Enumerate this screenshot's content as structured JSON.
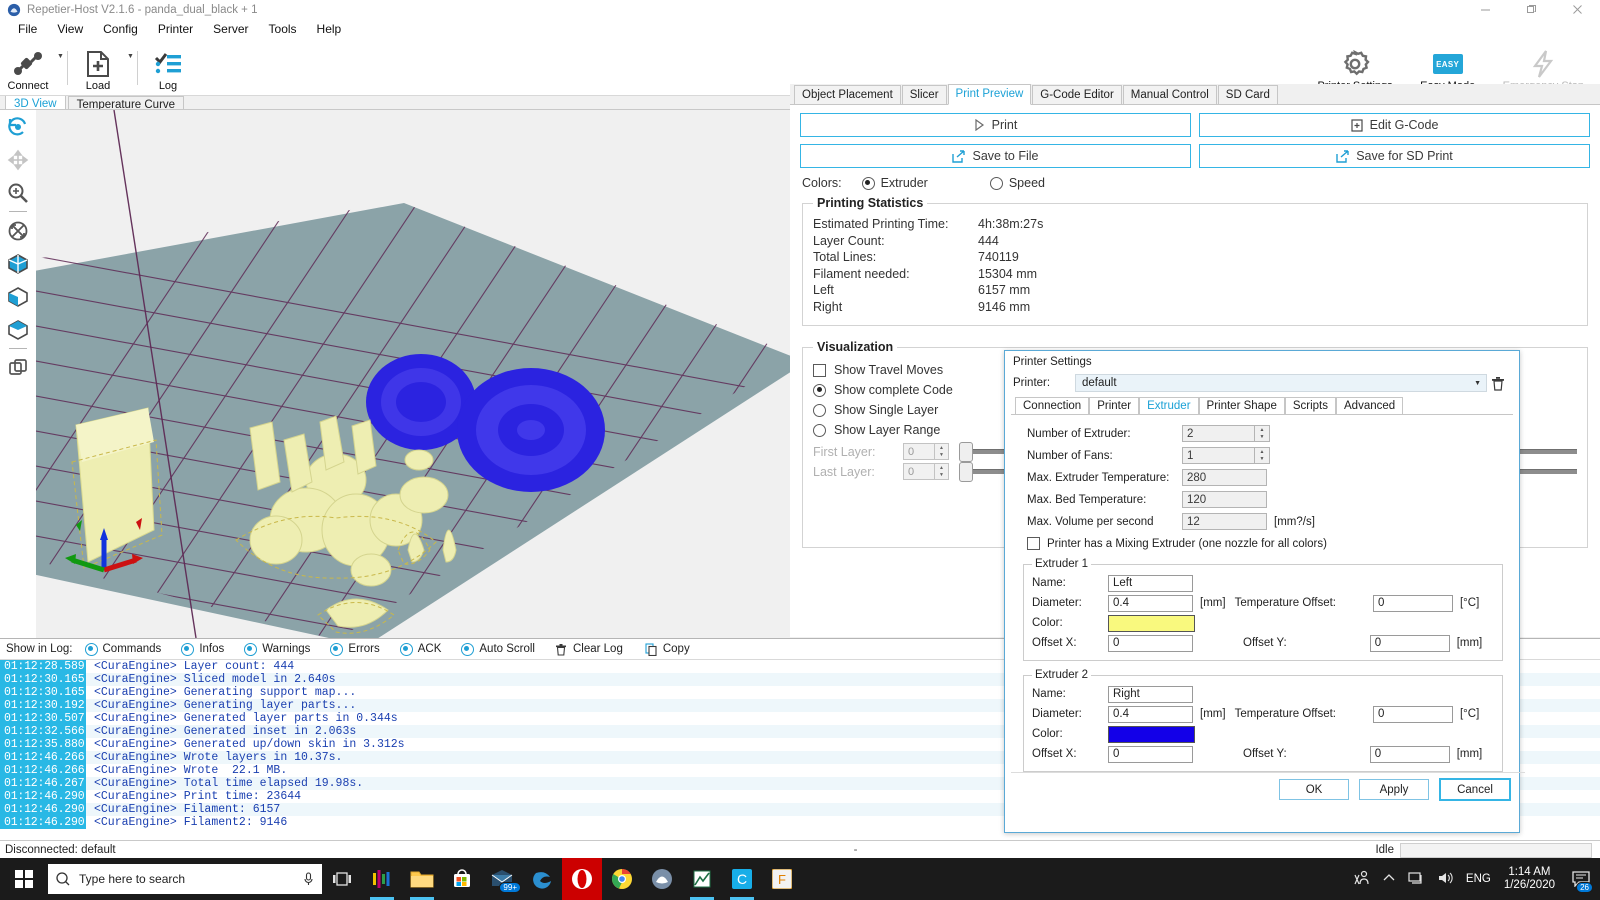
{
  "window": {
    "title": "Repetier-Host V2.1.6 - panda_dual_black + 1",
    "minimize": "—",
    "maximize": "❐",
    "close": "✕"
  },
  "menubar": {
    "items": [
      "File",
      "View",
      "Config",
      "Printer",
      "Server",
      "Tools",
      "Help"
    ]
  },
  "toolbar": {
    "connect": "Connect",
    "load": "Load",
    "log": "Log",
    "printer_settings": "Printer Settings",
    "easy_mode": "Easy Mode",
    "easy_badge": "EASY",
    "emergency_stop": "Emergency Stop"
  },
  "left_tabs": {
    "items": [
      "3D View",
      "Temperature Curve"
    ],
    "selected": "3D View"
  },
  "view_tools": [
    "rotate-view-icon",
    "move-view-icon",
    "zoom-view-icon",
    "center-view-icon",
    "view-solid-icon",
    "view-perspective-icon",
    "view-top-icon",
    "view-wire-icon"
  ],
  "right_tabs": {
    "items": [
      "Object Placement",
      "Slicer",
      "Print Preview",
      "G-Code Editor",
      "Manual Control",
      "SD Card"
    ],
    "selected": "Print Preview"
  },
  "actions": {
    "print": "Print",
    "edit_gcode": "Edit G-Code",
    "save_to_file": "Save to File",
    "save_for_sd": "Save for SD Print"
  },
  "colors_row": {
    "label": "Colors:",
    "extruder": "Extruder",
    "speed": "Speed",
    "selected": "Extruder"
  },
  "printing_statistics": {
    "legend": "Printing Statistics",
    "rows": [
      {
        "key": "Estimated Printing Time:",
        "value": "4h:38m:27s"
      },
      {
        "key": "Layer Count:",
        "value": "444"
      },
      {
        "key": "Total Lines:",
        "value": "740119"
      },
      {
        "key": "Filament needed:",
        "value": "15304 mm"
      },
      {
        "key": "Left",
        "value": "6157 mm"
      },
      {
        "key": "Right",
        "value": "9146 mm"
      }
    ]
  },
  "visualization": {
    "legend": "Visualization",
    "show_travel_moves": "Show Travel Moves",
    "show_complete_code": "Show complete Code",
    "show_single_layer": "Show Single Layer",
    "show_layer_range": "Show Layer Range",
    "selected": "Show complete Code",
    "first_layer_label": "First Layer:",
    "first_layer_value": "0",
    "last_layer_label": "Last Layer:",
    "last_layer_value": "0"
  },
  "log": {
    "show_in_log": "Show in Log:",
    "filters": [
      "Commands",
      "Infos",
      "Warnings",
      "Errors",
      "ACK",
      "Auto Scroll"
    ],
    "clear_log": "Clear Log",
    "copy": "Copy",
    "lines": [
      {
        "ts": "01:12:28.589",
        "msg": "<CuraEngine> Layer count: 444"
      },
      {
        "ts": "01:12:30.165",
        "msg": "<CuraEngine> Sliced model in 2.640s"
      },
      {
        "ts": "01:12:30.165",
        "msg": "<CuraEngine> Generating support map..."
      },
      {
        "ts": "01:12:30.192",
        "msg": "<CuraEngine> Generating layer parts..."
      },
      {
        "ts": "01:12:30.507",
        "msg": "<CuraEngine> Generated layer parts in 0.344s"
      },
      {
        "ts": "01:12:32.566",
        "msg": "<CuraEngine> Generated inset in 2.063s"
      },
      {
        "ts": "01:12:35.880",
        "msg": "<CuraEngine> Generated up/down skin in 3.312s"
      },
      {
        "ts": "01:12:46.266",
        "msg": "<CuraEngine> Wrote layers in 10.37s."
      },
      {
        "ts": "01:12:46.266",
        "msg": "<CuraEngine> Wrote  22.1 MB."
      },
      {
        "ts": "01:12:46.267",
        "msg": "<CuraEngine> Total time elapsed 19.98s."
      },
      {
        "ts": "01:12:46.290",
        "msg": "<CuraEngine> Print time: 23644"
      },
      {
        "ts": "01:12:46.290",
        "msg": "<CuraEngine> Filament: 6157"
      },
      {
        "ts": "01:12:46.290",
        "msg": "<CuraEngine> Filament2: 9146"
      }
    ]
  },
  "statusbar": {
    "left": "Disconnected: default",
    "middle": "-",
    "right": "Idle"
  },
  "dialog": {
    "title": "Printer Settings",
    "printer_label": "Printer:",
    "printer_value": "default",
    "tabs": [
      "Connection",
      "Printer",
      "Extruder",
      "Printer Shape",
      "Scripts",
      "Advanced"
    ],
    "selected_tab": "Extruder",
    "fields": [
      {
        "label": "Number of Extruder:",
        "value": "2",
        "unit": "",
        "type": "spinner"
      },
      {
        "label": "Number of Fans:",
        "value": "1",
        "unit": "",
        "type": "spinner"
      },
      {
        "label": "Max. Extruder Temperature:",
        "value": "280",
        "unit": "",
        "type": "text"
      },
      {
        "label": "Max. Bed Temperature:",
        "value": "120",
        "unit": "",
        "type": "text"
      },
      {
        "label": "Max. Volume per second",
        "value": "12",
        "unit": "[mm?/s]",
        "type": "text"
      }
    ],
    "mixing_checkbox": "Printer has a Mixing Extruder (one nozzle for all colors)",
    "extruder1": {
      "legend": "Extruder 1",
      "name_label": "Name:",
      "name_value": "Left",
      "diameter_label": "Diameter:",
      "diameter_value": "0.4",
      "diameter_unit": "[mm]",
      "temp_offset_label": "Temperature Offset:",
      "temp_offset_value": "0",
      "temp_offset_unit": "[°C]",
      "color_label": "Color:",
      "color_value": "#f9f97e",
      "offset_x_label": "Offset X:",
      "offset_x_value": "0",
      "offset_y_label": "Offset Y:",
      "offset_y_value": "0",
      "offset_unit": "[mm]"
    },
    "extruder2": {
      "legend": "Extruder 2",
      "name_label": "Name:",
      "name_value": "Right",
      "diameter_label": "Diameter:",
      "diameter_value": "0.4",
      "diameter_unit": "[mm]",
      "temp_offset_label": "Temperature Offset:",
      "temp_offset_value": "0",
      "temp_offset_unit": "[°C]",
      "color_label": "Color:",
      "color_value": "#1300e8",
      "offset_x_label": "Offset X:",
      "offset_x_value": "0",
      "offset_y_label": "Offset Y:",
      "offset_y_value": "0",
      "offset_unit": "[mm]"
    },
    "buttons": {
      "ok": "OK",
      "apply": "Apply",
      "cancel": "Cancel"
    }
  },
  "taskbar": {
    "search_placeholder": "Type here to search",
    "time": "1:14 AM",
    "date": "1/26/2020",
    "language": "ENG",
    "notification_count": "26"
  },
  "theme": {
    "accent": "#35b5e5",
    "tab_active_text": "#1ba1d6",
    "log_ts_bg": "#29b8e5",
    "log_text": "#1a3fb0",
    "bed": "#8ba3a8",
    "grid": "#5e2a55",
    "extruder1_color": "#f9f97e",
    "extruder2_color": "#1300e8"
  }
}
